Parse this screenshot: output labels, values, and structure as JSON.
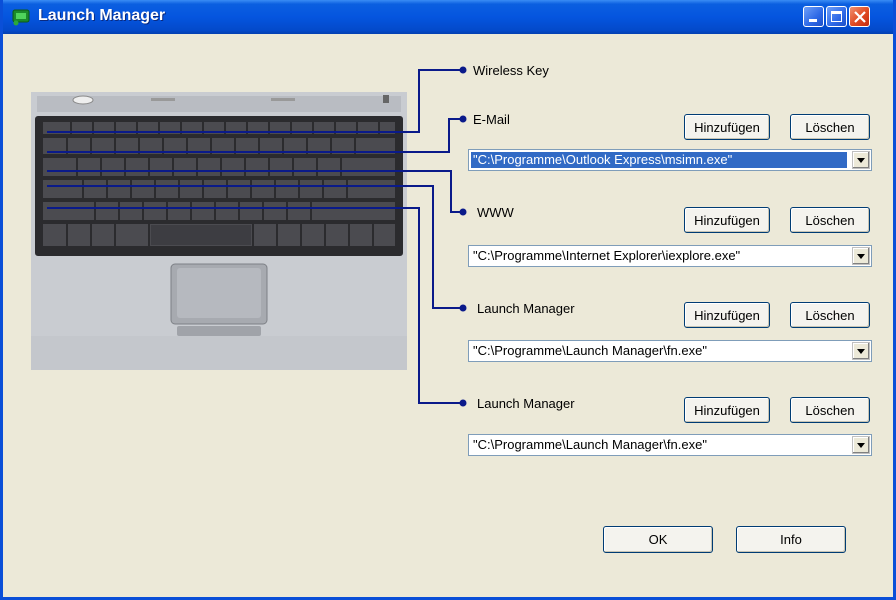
{
  "window": {
    "title": "Launch Manager",
    "titlebar_color": "#0555df",
    "connector_color": "#0a1a8a"
  },
  "keys": [
    {
      "label": "Wireless Key"
    },
    {
      "label": "E-Mail",
      "add": "Hinzufügen",
      "delete": "Löschen",
      "path": "\"C:\\Programme\\Outlook Express\\msimn.exe\""
    },
    {
      "label": "WWW",
      "add": "Hinzufügen",
      "delete": "Löschen",
      "path": "\"C:\\Programme\\Internet Explorer\\iexplore.exe\""
    },
    {
      "label": "Launch Manager",
      "add": "Hinzufügen",
      "delete": "Löschen",
      "path": "\"C:\\Programme\\Launch Manager\\fn.exe\""
    },
    {
      "label": "Launch Manager",
      "add": "Hinzufügen",
      "delete": "Löschen",
      "path": "\"C:\\Programme\\Launch Manager\\fn.exe\""
    }
  ],
  "buttons": {
    "ok": "OK",
    "info": "Info"
  }
}
